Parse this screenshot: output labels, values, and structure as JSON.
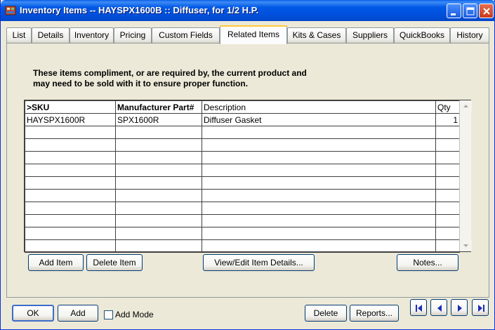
{
  "window": {
    "title": "Inventory Items -- HAYSPX1600B :: Diffuser, for 1/2 H.P."
  },
  "tabs": [
    {
      "label": "List",
      "active": false
    },
    {
      "label": "Details",
      "active": false
    },
    {
      "label": "Inventory",
      "active": false
    },
    {
      "label": "Pricing",
      "active": false
    },
    {
      "label": "Custom Fields",
      "active": false
    },
    {
      "label": "Related Items",
      "active": true
    },
    {
      "label": "Kits & Cases",
      "active": false
    },
    {
      "label": "Suppliers",
      "active": false
    },
    {
      "label": "QuickBooks",
      "active": false
    },
    {
      "label": "History",
      "active": false
    }
  ],
  "related": {
    "description_line1": "These items compliment, or are required by, the current product and",
    "description_line2": "may need to be sold with it to ensure proper function.",
    "columns": [
      ">SKU",
      "Manufacturer Part#",
      "Description",
      "Qty"
    ],
    "rows": [
      {
        "sku": "HAYSPX1600R",
        "mfr_part": "SPX1600R",
        "description": "Diffuser Gasket",
        "qty": "1"
      }
    ],
    "add_item": "Add Item",
    "delete_item": "Delete Item",
    "view_edit": "View/Edit Item Details...",
    "notes": "Notes..."
  },
  "footer": {
    "ok": "OK",
    "add": "Add",
    "add_mode": "Add Mode",
    "add_mode_checked": false,
    "delete": "Delete",
    "reports": "Reports..."
  },
  "icons": {
    "app": "inventory-app-icon",
    "minimize": "minimize-icon",
    "maximize": "maximize-icon",
    "close": "close-icon",
    "first": "first-record-icon",
    "prev": "previous-record-icon",
    "next": "next-record-icon",
    "last": "last-record-icon"
  },
  "colors": {
    "titlebar": "#0058E6",
    "window_bg": "#ECE9D8",
    "active_tab_accent": "#FFC83C",
    "nav_arrow": "#1C2FB4"
  }
}
